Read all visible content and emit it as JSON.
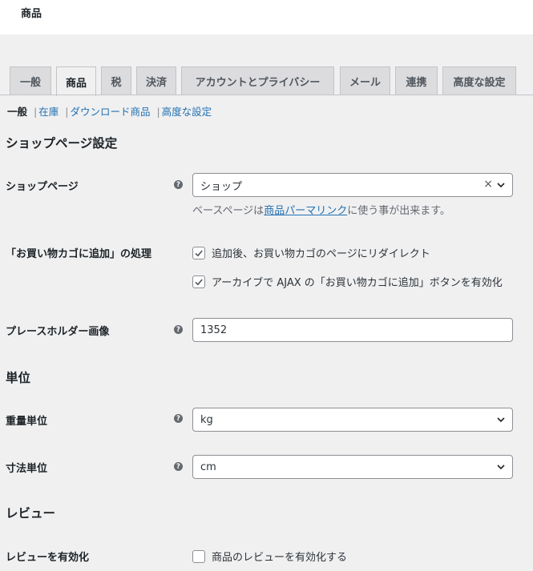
{
  "header": {
    "title": "商品"
  },
  "tabs": [
    {
      "label": "一般"
    },
    {
      "label": "商品"
    },
    {
      "label": "税"
    },
    {
      "label": "決済"
    },
    {
      "label": "アカウントとプライバシー"
    },
    {
      "label": "メール"
    },
    {
      "label": "連携"
    },
    {
      "label": "高度な設定"
    }
  ],
  "active_tab": "商品",
  "subnav": {
    "current": "一般",
    "links": [
      "在庫",
      "ダウンロード商品",
      "高度な設定"
    ],
    "separator": "|"
  },
  "sections": {
    "shop_page_settings": "ショップページ設定",
    "units": "単位",
    "reviews": "レビュー"
  },
  "shop_page": {
    "label": "ショップページ",
    "value": "ショップ",
    "desc_prefix": "ベースページは",
    "desc_link": "商品パーマリンク",
    "desc_suffix": "に使う事が出来ます。"
  },
  "add_to_cart": {
    "label": "「お買い物カゴに追加」の処理",
    "options": [
      {
        "label": "追加後、お買い物カゴのページにリダイレクト",
        "checked": true
      },
      {
        "label": "アーカイブで AJAX の「お買い物カゴに追加」ボタンを有効化",
        "checked": true
      }
    ]
  },
  "placeholder_image": {
    "label": "プレースホルダー画像",
    "value": "1352"
  },
  "weight_unit": {
    "label": "重量単位",
    "value": "kg"
  },
  "dimension_unit": {
    "label": "寸法単位",
    "value": "cm"
  },
  "enable_reviews": {
    "label": "レビューを有効化",
    "option": {
      "label": "商品のレビューを有効化する",
      "checked": false
    }
  },
  "icons": {
    "help": "help-icon",
    "dropdown": "chevron-down-icon",
    "clear": "clear-x-icon",
    "check": "checkmark-icon"
  },
  "colors": {
    "link": "#2271b1",
    "tab_bg": "#dcdcde",
    "page_bg": "#f0f0f1"
  }
}
